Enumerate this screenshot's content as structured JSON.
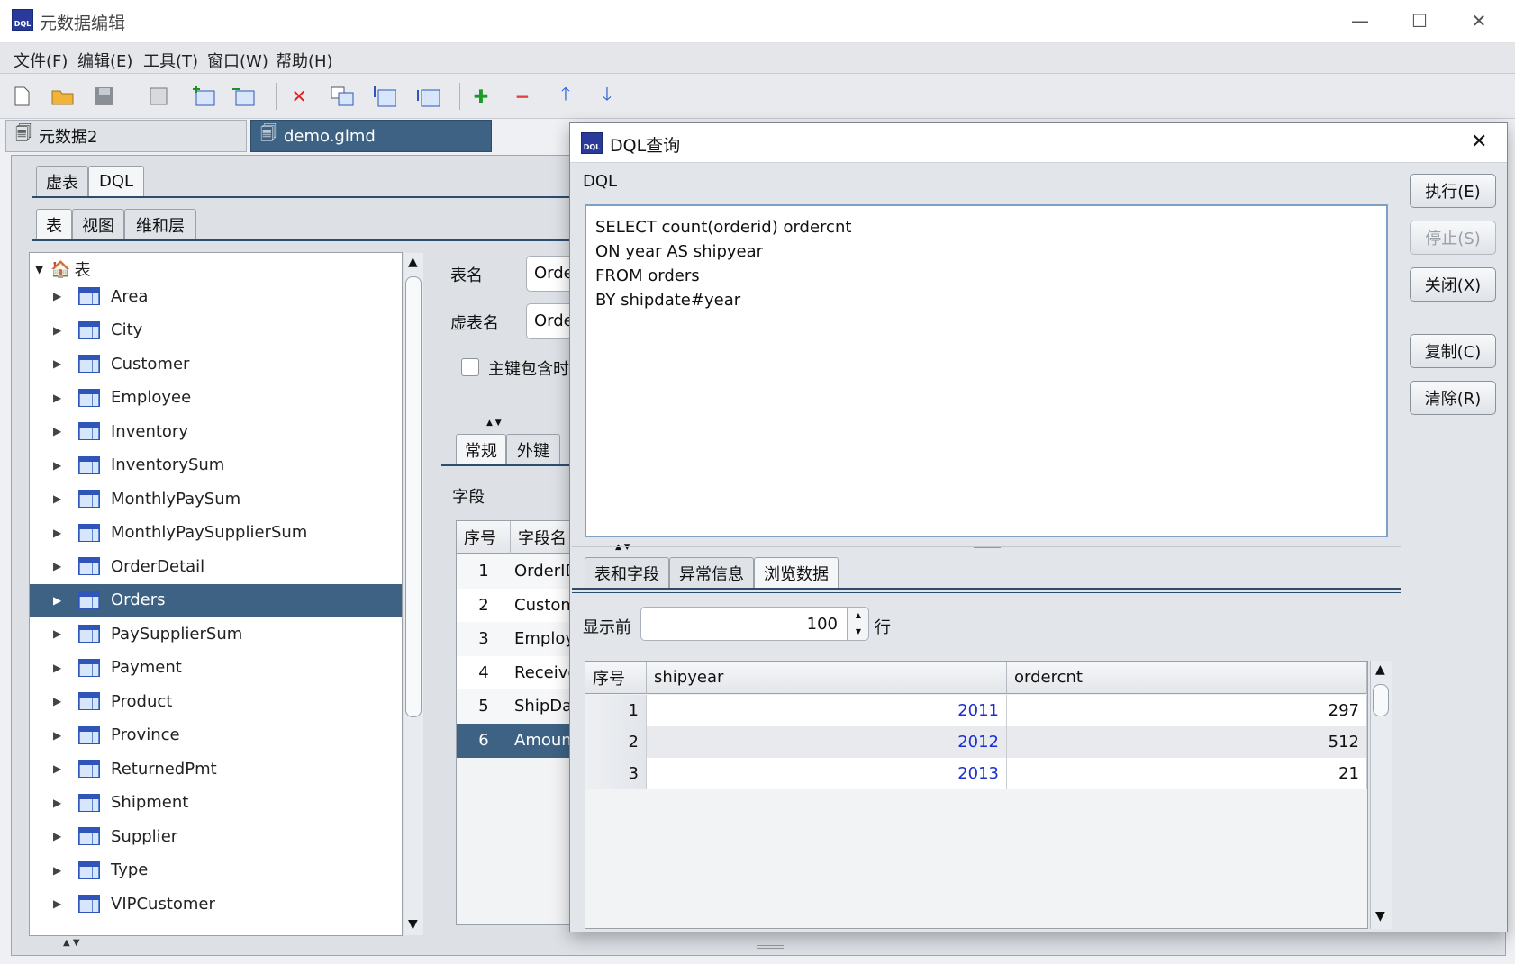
{
  "window": {
    "title": "元数据编辑",
    "minimize": "—",
    "maximize": "☐",
    "close": "✕"
  },
  "menu": [
    "文件(F)",
    "编辑(E)",
    "工具(T)",
    "窗口(W)",
    "帮助(H)"
  ],
  "file_tabs": [
    "元数据2",
    "demo.glmd"
  ],
  "left": {
    "top_tabs": [
      "虚表",
      "DQL"
    ],
    "sub_tabs": [
      "表",
      "视图",
      "维和层"
    ],
    "tree_root": "表",
    "tree_items": [
      "Area",
      "City",
      "Customer",
      "Employee",
      "Inventory",
      "InventorySum",
      "MonthlyPaySum",
      "MonthlyPaySupplierSum",
      "OrderDetail",
      "Orders",
      "PaySupplierSum",
      "Payment",
      "Product",
      "Province",
      "ReturnedPmt",
      "Shipment",
      "Supplier",
      "Type",
      "VIPCustomer"
    ],
    "selected_item": "Orders"
  },
  "middle": {
    "table_name_label": "表名",
    "table_name_value": "Orders",
    "virtual_name_label": "虚表名",
    "virtual_name_value": "Orders",
    "pk_checkbox_label": "主键包含时",
    "tabs": [
      "常规",
      "外键"
    ],
    "fields_label": "字段",
    "col_headers": [
      "序号",
      "字段名"
    ],
    "rows": [
      {
        "n": "1",
        "name": "OrderID"
      },
      {
        "n": "2",
        "name": "CustomerID"
      },
      {
        "n": "3",
        "name": "EmployeeID"
      },
      {
        "n": "4",
        "name": "ReceiverName"
      },
      {
        "n": "5",
        "name": "ShipDate"
      },
      {
        "n": "6",
        "name": "Amount"
      }
    ]
  },
  "dialog": {
    "title": "DQL查询",
    "close": "✕",
    "dql_label": "DQL",
    "sql_lines": [
      "SELECT count(orderid) ordercnt",
      "ON year AS shipyear",
      "FROM orders",
      "BY shipdate#year"
    ],
    "buttons": {
      "execute": "执行(E)",
      "stop": "停止(S)",
      "close": "关闭(X)",
      "copy": "复制(C)",
      "clear": "清除(R)"
    },
    "result_tabs": [
      "表和字段",
      "异常信息",
      "浏览数据"
    ],
    "show_label": "显示前",
    "show_count": "100",
    "rows_unit": "行",
    "grid_headers": [
      "序号",
      "shipyear",
      "ordercnt"
    ],
    "grid_rows": [
      {
        "n": "1",
        "shipyear": "2011",
        "ordercnt": "297"
      },
      {
        "n": "2",
        "shipyear": "2012",
        "ordercnt": "512"
      },
      {
        "n": "3",
        "shipyear": "2013",
        "ordercnt": "21"
      }
    ]
  },
  "icons": {
    "app": "DQL"
  }
}
